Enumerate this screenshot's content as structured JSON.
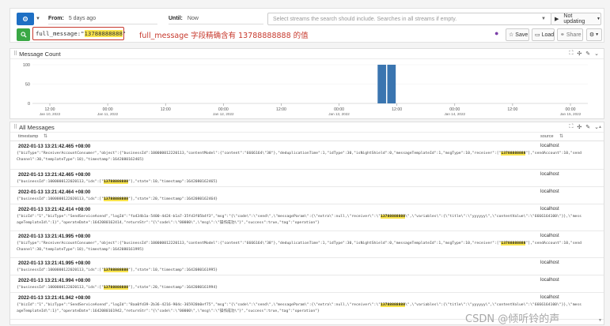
{
  "search": {
    "from_label": "From:",
    "from_value": "5 days ago",
    "until_label": "Until:",
    "until_value": "Now",
    "streams_placeholder": "Select streams the search should include. Searches in all streams if empty.",
    "update_label": "Not updating",
    "query_key": "full_message:",
    "query_value": "13788888888",
    "annotation": "full_message 字段精确含有 13788888888 的值",
    "save_label": "Save",
    "load_label": "Load",
    "share_label": "Share"
  },
  "message_count": {
    "title": "Message Count"
  },
  "chart_data": {
    "type": "bar",
    "title": "Message Count",
    "ylim": [
      0,
      100
    ],
    "y_ticks": [
      "100",
      "50",
      "0"
    ],
    "x_ticks": [
      {
        "time": "12:00",
        "date": "Jan 10, 2022"
      },
      {
        "time": "00:00",
        "date": "Jan 11, 2022"
      },
      {
        "time": "12:00",
        "date": ""
      },
      {
        "time": "00:00",
        "date": "Jan 12, 2022"
      },
      {
        "time": "12:00",
        "date": ""
      },
      {
        "time": "00:00",
        "date": "Jan 13, 2022"
      },
      {
        "time": "12:00",
        "date": ""
      },
      {
        "time": "00:00",
        "date": "Jan 14, 2022"
      },
      {
        "time": "12:00",
        "date": ""
      },
      {
        "time": "00:00",
        "date": "Jan 15, 2022"
      }
    ],
    "bars": [
      {
        "x": "2022-01-13 08:00",
        "value": 100
      },
      {
        "x": "2022-01-13 10:00",
        "value": 100
      }
    ]
  },
  "all_messages": {
    "title": "All Messages",
    "col_timestamp": "timestamp",
    "col_source": "source",
    "rows": [
      {
        "ts": "2022-01-13 13:21:42.465 +08:00",
        "source": "localhost",
        "body": [
          "{\"bizType\":\"ReceiverAccountConsumer\",\"object\":{\"businessId\":100000012220113,\"contentModel\":{\"content\":\"6666164\\\"38\"},\"deduplicationTime\":1,\"idType\":30,\"isNightShield\":0,\"messageTemplateId\":1,\"msgType\":10,\"receiver\":[\"",
          "13788888888",
          "\"],\"sendAccount\":10,\"sendChannel\":30,\"templateType\":10},\"timestamp\":1642080162465}"
        ]
      },
      {
        "ts": "2022-01-13 13:21:42.465 +08:00",
        "source": "localhost",
        "body": [
          "{\"businessId\":1000000122020113,\"ids\":[\"",
          "13788888888",
          "\"],\"state\":10,\"timestamp\":1642080162465}"
        ]
      },
      {
        "ts": "2022-01-13 13:21:42.464 +08:00",
        "source": "localhost",
        "body": [
          "{\"businessId\":1000000122020113,\"ids\":[\"",
          "13788888888",
          "\"],\"state\":20,\"timestamp\":1642080162464}"
        ]
      },
      {
        "ts": "2022-01-13 13:21:42.414 +08:00",
        "source": "localhost",
        "body": [
          "{\"bizId\":\"1\",\"bizType\":\"SendServiceAsend\",\"logId\":\"fa434b1a-5400-4d24-b1a7-35fd3f05b4f3\",\"msg\":\"{\\\"code\\\":\\\"send\\\",\\\"messageParam\\\":{\\\"extra\\\":null,\\\"receiver\\\":\\\"",
          "13788888888",
          "\\\",\\\"variables\\\":{\\\"title\\\":\\\"yyyyyy\\\",\\\"contentValue\\\":\\\"6666164100\\\"}},\\\"messageTemplateId\\\":1}\",\"operateDate\":1642080162414,\"returnStr\":\"{\\\"code\\\":\\\"00000\\\",\\\"msg\\\":\\\"操作成功\\\"}\",\"success\":true,\"tag\":\"operation\"}"
        ]
      },
      {
        "ts": "2022-01-13 13:21:41.995 +08:00",
        "source": "localhost",
        "body": [
          "{\"bizType\":\"ReceiverAccountConsumer\",\"object\":{\"businessId\":100000012220113,\"contentModel\":{\"content\":\"6666164\\\"38\"},\"deduplicationTime\":1,\"idType\":30,\"isNightShield\":0,\"messageTemplateId\":1,\"msgType\":10,\"receiver\":[\"",
          "13788888888",
          "\"],\"sendAccount\":10,\"sendChannel\":30,\"templateType\":10},\"timestamp\":1642080161995}"
        ]
      },
      {
        "ts": "2022-01-13 13:21:41.995 +08:00",
        "source": "localhost",
        "body": [
          "{\"businessId\":1000000122020113,\"ids\":[\"",
          "13788888888",
          "\"],\"state\":10,\"timestamp\":1642080161995}"
        ]
      },
      {
        "ts": "2022-01-13 13:21:41.994 +08:00",
        "source": "localhost",
        "body": [
          "{\"businessId\":1000000122020113,\"ids\":[\"",
          "13788888888",
          "\"],\"state\":20,\"timestamp\":1642080161994}"
        ]
      },
      {
        "ts": "2022-01-13 13:21:41.942 +08:00",
        "source": "localhost",
        "body": [
          "{\"bizId\":\"1\",\"bizType\":\"SendServiceAsend\",\"logId\":\"8aa0fd39-2b36-4216-904c-365920b0ef75\",\"msg\":\"{\\\"code\\\":\\\"send\\\",\\\"messageParam\\\":{\\\"extra\\\":null,\\\"receiver\\\":\\\"",
          "13788888888",
          "\\\",\\\"variables\\\":{\\\"title\\\":\\\"yyyyyy\\\",\\\"contentValue\\\":\\\"6666164100\\\"}},\\\"messageTemplateId\\\":1}\",\"operateDate\":1642080161942,\"returnStr\":\"{\\\"code\\\":\\\"00000\\\",\\\"msg\\\":\\\"操作成功\\\"}\",\"success\":true,\"tag\":\"operation\"}"
        ]
      }
    ]
  },
  "watermark": "CSDN @倾听铃的声"
}
